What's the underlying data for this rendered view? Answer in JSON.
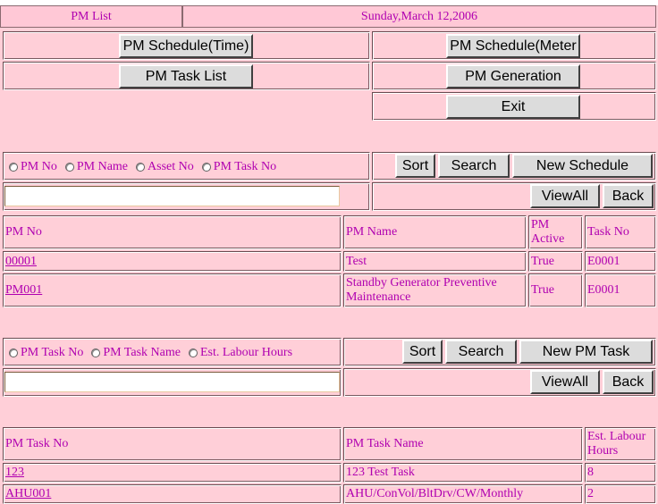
{
  "header": {
    "title": "PM List",
    "date": "Sunday,March 12,2006"
  },
  "menu": {
    "pm_schedule_time": "PM Schedule(Time)",
    "pm_schedule_meter": "PM Schedule(Meter",
    "pm_task_list": "PM Task List",
    "pm_generation": "PM Generation",
    "exit": "Exit"
  },
  "schedule_section": {
    "radios": [
      "PM No",
      "PM Name",
      "Asset No",
      "PM Task No"
    ],
    "sort": "Sort",
    "search": "Search",
    "new": "New Schedule",
    "viewall": "ViewAll",
    "back": "Back",
    "search_value": "",
    "columns": [
      "PM No",
      "PM Name",
      "PM Active",
      "Task No"
    ],
    "rows": [
      {
        "pm_no": "00001",
        "pm_name": "Test",
        "active": "True",
        "task_no": "E0001"
      },
      {
        "pm_no": "PM001",
        "pm_name": "Standby Generator Preventive Maintenance",
        "active": "True",
        "task_no": "E0001"
      }
    ]
  },
  "task_section": {
    "radios": [
      "PM Task No",
      "PM Task Name",
      "Est. Labour Hours"
    ],
    "sort": "Sort",
    "search": "Search",
    "new": "New PM Task",
    "viewall": "ViewAll",
    "back": "Back",
    "search_value": "",
    "columns": [
      "PM Task No",
      "PM Task Name",
      "Est. Labour Hours"
    ],
    "rows": [
      {
        "task_no": "123",
        "task_name": "123 Test Task",
        "hours": "8"
      },
      {
        "task_no": "AHU001",
        "task_name": "AHU/ConVol/BltDrv/CW/Monthly",
        "hours": "2"
      }
    ]
  }
}
